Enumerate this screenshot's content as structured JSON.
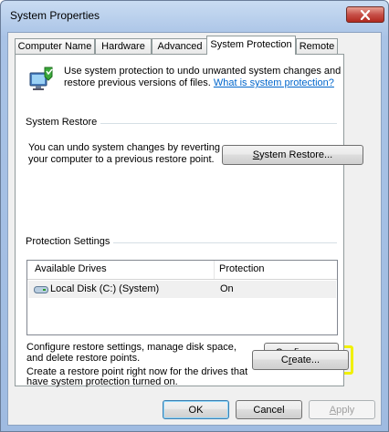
{
  "window": {
    "title": "System Properties"
  },
  "tabs": [
    "Computer Name",
    "Hardware",
    "Advanced",
    "System Protection",
    "Remote"
  ],
  "active_tab": "System Protection",
  "intro": {
    "line1": "Use system protection to undo unwanted system changes and",
    "line2": "restore previous versions of files.",
    "link": "What is system protection?"
  },
  "system_restore": {
    "group_title": "System Restore",
    "desc_line1": "You can undo system changes by reverting",
    "desc_line2": "your computer to a previous restore point.",
    "button_prefix": "",
    "button_accel": "S",
    "button_rest": "ystem Restore..."
  },
  "protection": {
    "group_title": "Protection Settings",
    "columns": [
      "Available Drives",
      "Protection"
    ],
    "rows": [
      {
        "drive": "Local Disk (C:) (System)",
        "protection": "On",
        "icon": "hard-drive-icon"
      }
    ],
    "configure_line1": "Configure restore settings, manage disk space,",
    "configure_line2": "and delete restore points.",
    "configure_accel": "C",
    "configure_rest": "onfigure...",
    "create_line1": "Create a restore point right now for the drives that",
    "create_line2": "have system protection turned on.",
    "create_prefix": "C",
    "create_accel": "r",
    "create_rest": "eate..."
  },
  "footer": {
    "ok": "OK",
    "cancel": "Cancel",
    "apply_accel": "A",
    "apply_rest": "pply"
  },
  "colors": {
    "highlight": "#f0f000",
    "link": "#0066cc"
  }
}
